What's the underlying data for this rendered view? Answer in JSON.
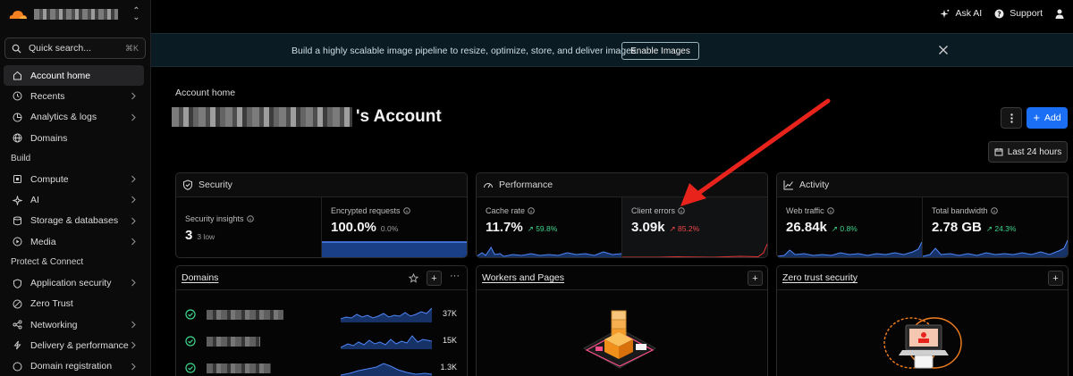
{
  "sidebar": {
    "search_placeholder": "Quick search...",
    "search_shortcut": "⌘K",
    "items": [
      {
        "label": "Account home",
        "icon": "home-icon",
        "active": true
      },
      {
        "label": "Recents",
        "icon": "clock-icon"
      },
      {
        "label": "Analytics & logs",
        "icon": "analytics-icon"
      },
      {
        "label": "Domains",
        "icon": "globe-icon"
      }
    ],
    "section_build": "Build",
    "build_items": [
      {
        "label": "Compute",
        "icon": "compute-icon"
      },
      {
        "label": "AI",
        "icon": "ai-sparkle-icon"
      },
      {
        "label": "Storage & databases",
        "icon": "database-icon"
      },
      {
        "label": "Media",
        "icon": "media-icon"
      }
    ],
    "section_protect": "Protect & Connect",
    "protect_items": [
      {
        "label": "Application security",
        "icon": "shield-icon"
      },
      {
        "label": "Zero Trust",
        "icon": "zero-trust-icon"
      },
      {
        "label": "Networking",
        "icon": "network-icon"
      },
      {
        "label": "Delivery & performance",
        "icon": "lightning-icon"
      },
      {
        "label": "Domain registration",
        "icon": "registration-icon"
      }
    ]
  },
  "topbar": {
    "ask_ai": "Ask AI",
    "support": "Support"
  },
  "banner": {
    "message": "Build a highly scalable image pipeline to resize, optimize, store, and deliver images.",
    "button": "Enable Images"
  },
  "header": {
    "breadcrumb": "Account home",
    "title_suffix": "'s Account",
    "add_label": "Add",
    "time_range": "Last 24 hours"
  },
  "security": {
    "title": "Security",
    "insights_label": "Security insights",
    "insights_value": "3",
    "insights_sub": "3 low",
    "encrypted_label": "Encrypted requests",
    "encrypted_value": "100.0%",
    "encrypted_delta": "0.0%"
  },
  "performance": {
    "title": "Performance",
    "cache_label": "Cache rate",
    "cache_value": "11.7%",
    "cache_delta": "↗ 59.8%",
    "errors_label": "Client errors",
    "errors_value": "3.09k",
    "errors_delta": "↗ 85.2%"
  },
  "activity": {
    "title": "Activity",
    "traffic_label": "Web traffic",
    "traffic_value": "26.84k",
    "traffic_delta": "↗ 0.8%",
    "bandwidth_label": "Total bandwidth",
    "bandwidth_value": "2.78 GB",
    "bandwidth_delta": "↗ 24.3%"
  },
  "domains": {
    "title": "Domains",
    "rows": [
      {
        "count": "37K"
      },
      {
        "count": "15K"
      },
      {
        "count": "1.3K"
      }
    ]
  },
  "workers": {
    "title": "Workers and Pages"
  },
  "zerotrust": {
    "title": "Zero trust security"
  },
  "colors": {
    "accent": "#1a6ff5",
    "positive": "#3dd68c",
    "negative": "#f04848",
    "brand": "#f38020",
    "annotation": "#e8231c"
  }
}
